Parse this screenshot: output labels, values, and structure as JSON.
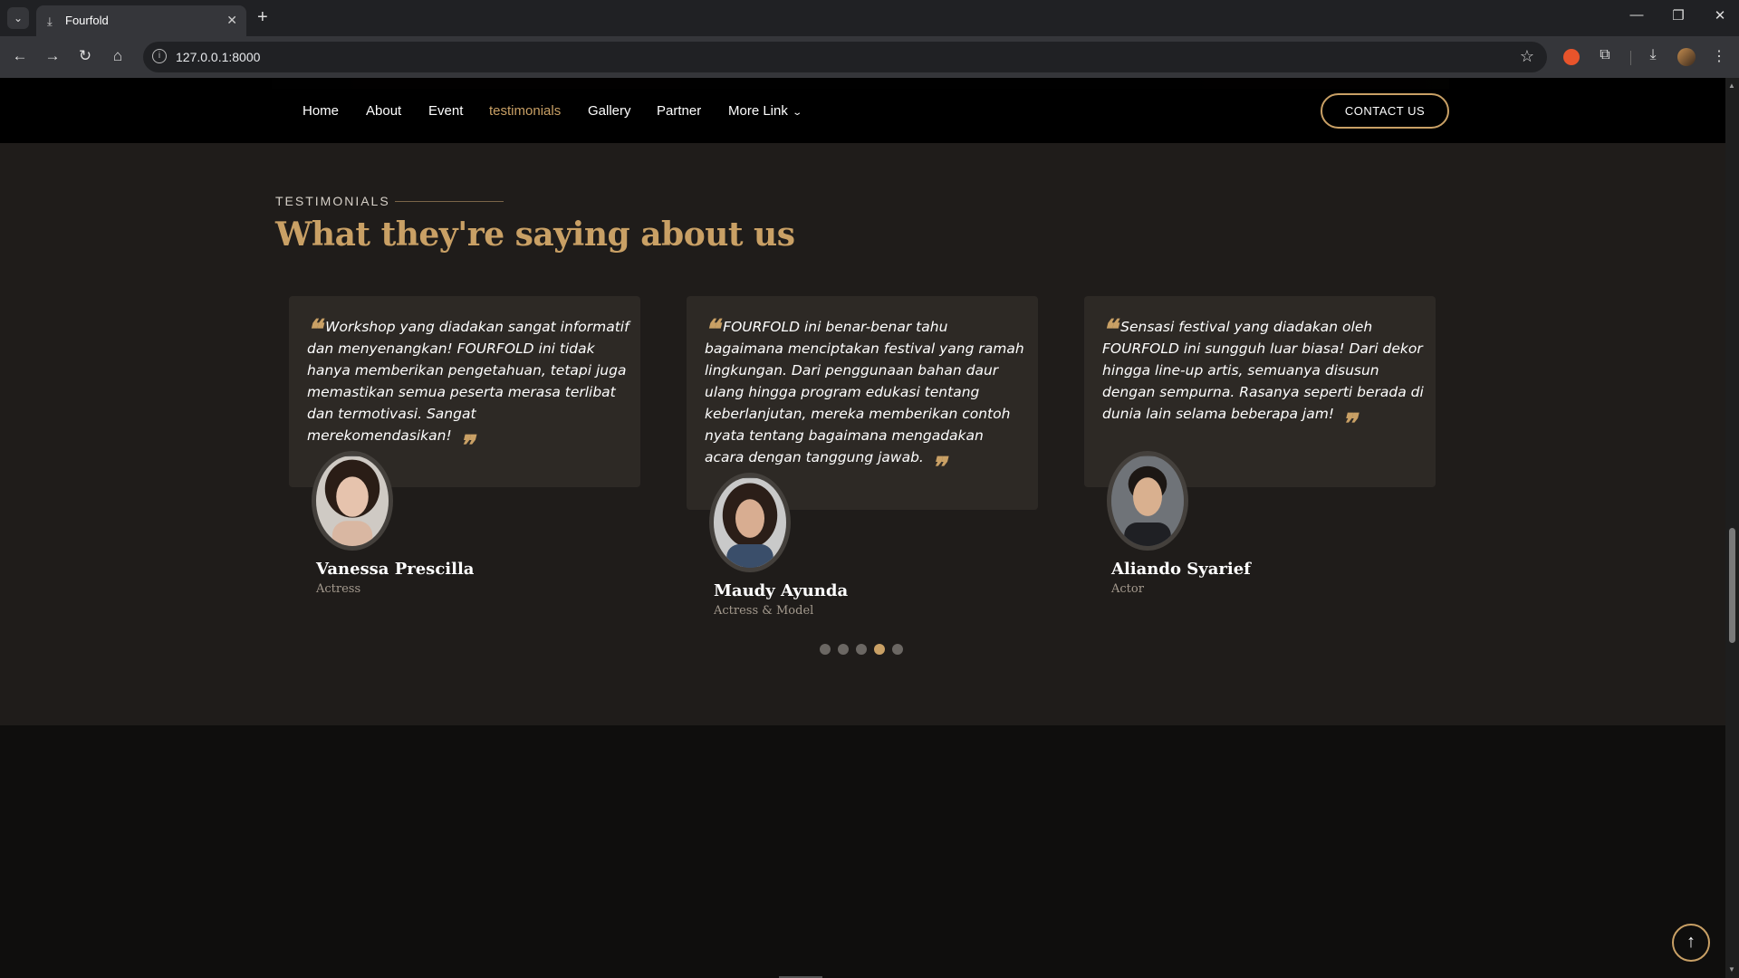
{
  "browser": {
    "tab_title": "Fourfold",
    "url": "127.0.0.1:8000"
  },
  "nav": {
    "links": [
      "Home",
      "About",
      "Event",
      "testimonials",
      "Gallery",
      "Partner",
      "More Link"
    ],
    "active": "testimonials",
    "contact_label": "CONTACT US"
  },
  "testimonials": {
    "eyebrow": "TESTIMONIALS",
    "heading": "What they're saying about us",
    "items": [
      {
        "quote": "Workshop yang diadakan sangat informatif dan menyenangkan! FOURFOLD ini tidak hanya memberikan pengetahuan, tetapi juga memastikan semua peserta merasa terlibat dan termotivasi. Sangat merekomendasikan!",
        "name": "Vanessa Prescilla",
        "role": "Actress"
      },
      {
        "quote": "FOURFOLD ini benar-benar tahu bagaimana menciptakan festival yang ramah lingkungan. Dari penggunaan bahan daur ulang hingga program edukasi tentang keberlanjutan, mereka memberikan contoh nyata tentang bagaimana mengadakan acara dengan tanggung jawab.",
        "name": "Maudy Ayunda",
        "role": "Actress & Model"
      },
      {
        "quote": "Sensasi festival yang diadakan oleh FOURFOLD ini sungguh luar biasa! Dari dekor hingga line-up artis, semuanya disusun dengan sempurna. Rasanya seperti berada di dunia lain selama beberapa jam!",
        "name": "Aliando Syarief",
        "role": "Actor"
      }
    ],
    "pagination": {
      "count": 5,
      "active_index": 3
    }
  },
  "colors": {
    "accent": "#c9a065",
    "section_bg": "#1f1c1a",
    "card_bg": "#2d2925",
    "page_bg": "#0f0e0d"
  },
  "icons": {
    "quote_open": "❝",
    "quote_close": "❞",
    "back_to_top": "↑"
  }
}
